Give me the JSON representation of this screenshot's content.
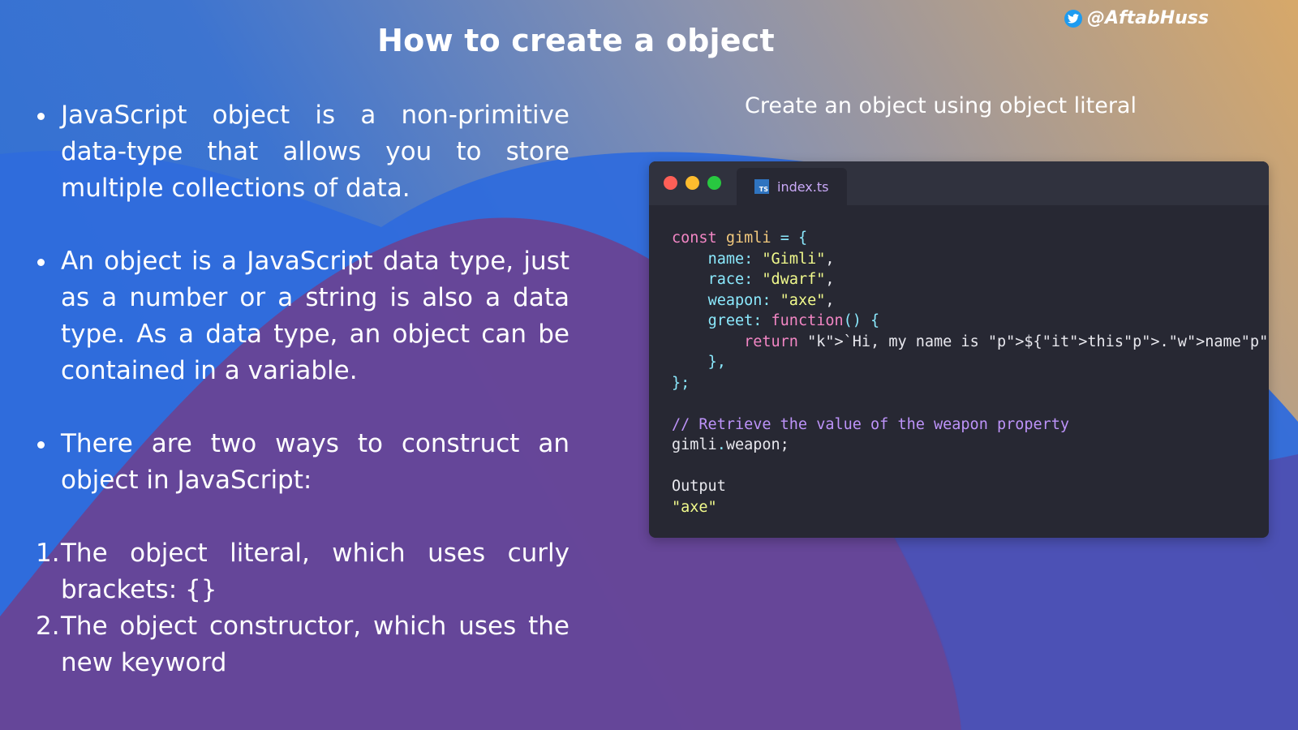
{
  "slide": {
    "title": "How to create a object",
    "handle": "@AftabHuss",
    "handle_icon": "twitter-bird-icon"
  },
  "left": {
    "bullets": [
      "JavaScript object is a non-primitive data-type that allows you to store multiple collections of data.",
      "An object is a JavaScript data type, just as a number or a string is also a data type. As a data type, an object can be contained in a variable.",
      "There are two ways to construct an object in JavaScript:"
    ],
    "numbered": [
      {
        "num": "1.",
        "text": "The object literal, which uses curly brackets: {}"
      },
      {
        "num": "2.",
        "text": "The object constructor, which uses the new keyword"
      }
    ]
  },
  "right": {
    "subtitle": "Create an object using object literal",
    "editor": {
      "tab_label": "index.ts",
      "tab_icon_label": "TS",
      "code_lines": [
        "const gimli = {",
        "    name: \"Gimli\",",
        "    race: \"dwarf\",",
        "    weapon: \"axe\",",
        "    greet: function() {",
        "        return `Hi, my name is ${this.name}!`;",
        "    },",
        "};",
        "",
        "// Retrieve the value of the weapon property",
        "gimli.weapon;",
        "",
        "Output",
        "\"axe\""
      ]
    }
  },
  "colors": {
    "gradient_start": "#2b6fd6",
    "gradient_end": "#d7a869",
    "shape_blue": "#2e6ddc",
    "shape_purple": "#6a4393",
    "editor_bg": "#272833",
    "editor_titlebar": "#30323e"
  }
}
